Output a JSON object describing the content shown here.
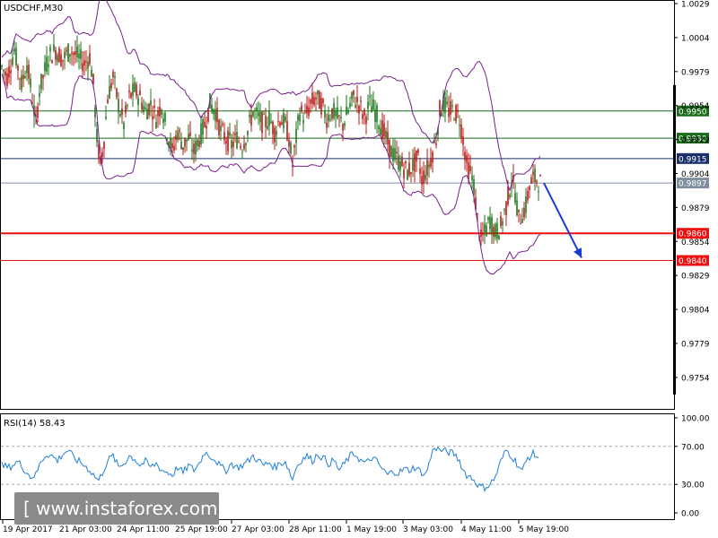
{
  "chart_data": [
    {
      "type": "candlestick",
      "title": "USDCHF,M30",
      "y_ticks": [
        "1.0029",
        "1.0004",
        "0.9979",
        "0.9954",
        "0.9929",
        "0.9904",
        "0.9879",
        "0.9854",
        "0.9829",
        "0.9804",
        "0.9779",
        "0.9754"
      ],
      "x_ticks": [
        "19 Apr 2017",
        "21 Apr 03:00",
        "24 Apr 11:00",
        "25 Apr 19:00",
        "27 Apr 03:00",
        "28 Apr 11:00",
        "1 May 19:00",
        "3 May 03:00",
        "4 May 11:00",
        "5 May 19:00"
      ],
      "levels": [
        {
          "label": "0.9950",
          "value": 0.995,
          "color": "#1a6b1a"
        },
        {
          "label": "0.9930",
          "value": 0.993,
          "color": "#1a6b1a"
        },
        {
          "label": "0.9915",
          "value": 0.9915,
          "color": "#1a2f6b"
        },
        {
          "label": "0.9897",
          "value": 0.9897,
          "color": "#7f8f9f"
        },
        {
          "label": "0.9860",
          "value": 0.986,
          "color": "#ee1111"
        },
        {
          "label": "0.9840",
          "value": 0.984,
          "color": "#ee1111"
        }
      ],
      "price_path": [
        [
          0,
          0.9985
        ],
        [
          8,
          0.9975
        ],
        [
          16,
          0.9995
        ],
        [
          24,
          0.997
        ],
        [
          30,
          0.9985
        ],
        [
          36,
          0.996
        ],
        [
          40,
          0.994
        ],
        [
          44,
          0.9965
        ],
        [
          48,
          0.9975
        ],
        [
          54,
          0.999
        ],
        [
          62,
          0.9995
        ],
        [
          70,
          0.9988
        ],
        [
          78,
          0.9995
        ],
        [
          86,
          0.999
        ],
        [
          94,
          0.9985
        ],
        [
          100,
          0.999
        ],
        [
          104,
          0.997
        ],
        [
          108,
          0.993
        ],
        [
          112,
          0.991
        ],
        [
          116,
          0.993
        ],
        [
          120,
          0.996
        ],
        [
          126,
          0.9975
        ],
        [
          132,
          0.9955
        ],
        [
          138,
          0.994
        ],
        [
          144,
          0.996
        ],
        [
          150,
          0.9965
        ],
        [
          156,
          0.996
        ],
        [
          162,
          0.995
        ],
        [
          168,
          0.9955
        ],
        [
          174,
          0.9945
        ],
        [
          180,
          0.9955
        ],
        [
          186,
          0.9935
        ],
        [
          192,
          0.992
        ],
        [
          198,
          0.9935
        ],
        [
          204,
          0.9925
        ],
        [
          210,
          0.993
        ],
        [
          216,
          0.992
        ],
        [
          222,
          0.993
        ],
        [
          228,
          0.994
        ],
        [
          234,
          0.9955
        ],
        [
          240,
          0.995
        ],
        [
          246,
          0.9935
        ],
        [
          252,
          0.993
        ],
        [
          258,
          0.9925
        ],
        [
          264,
          0.993
        ],
        [
          270,
          0.9925
        ],
        [
          276,
          0.9935
        ],
        [
          282,
          0.995
        ],
        [
          288,
          0.9945
        ],
        [
          294,
          0.994
        ],
        [
          300,
          0.9945
        ],
        [
          306,
          0.9935
        ],
        [
          312,
          0.9945
        ],
        [
          318,
          0.994
        ],
        [
          322,
          0.993
        ],
        [
          326,
          0.991
        ],
        [
          330,
          0.993
        ],
        [
          334,
          0.995
        ],
        [
          340,
          0.9945
        ],
        [
          346,
          0.9955
        ],
        [
          352,
          0.996
        ],
        [
          358,
          0.9955
        ],
        [
          364,
          0.9945
        ],
        [
          370,
          0.995
        ],
        [
          376,
          0.9945
        ],
        [
          382,
          0.994
        ],
        [
          388,
          0.995
        ],
        [
          394,
          0.996
        ],
        [
          400,
          0.9955
        ],
        [
          406,
          0.9945
        ],
        [
          412,
          0.9955
        ],
        [
          418,
          0.995
        ],
        [
          424,
          0.994
        ],
        [
          430,
          0.993
        ],
        [
          436,
          0.992
        ],
        [
          442,
          0.9915
        ],
        [
          448,
          0.991
        ],
        [
          454,
          0.9905
        ],
        [
          460,
          0.991
        ],
        [
          466,
          0.9915
        ],
        [
          470,
          0.99
        ],
        [
          474,
          0.9905
        ],
        [
          478,
          0.991
        ],
        [
          482,
          0.992
        ],
        [
          486,
          0.993
        ],
        [
          490,
          0.995
        ],
        [
          494,
          0.9955
        ],
        [
          500,
          0.995
        ],
        [
          506,
          0.995
        ],
        [
          512,
          0.9945
        ],
        [
          516,
          0.993
        ],
        [
          520,
          0.991
        ],
        [
          524,
          0.9905
        ],
        [
          528,
          0.9895
        ],
        [
          532,
          0.987
        ],
        [
          536,
          0.9855
        ],
        [
          540,
          0.986
        ],
        [
          546,
          0.987
        ],
        [
          552,
          0.986
        ],
        [
          558,
          0.9865
        ],
        [
          564,
          0.988
        ],
        [
          570,
          0.99
        ],
        [
          574,
          0.989
        ],
        [
          578,
          0.987
        ],
        [
          582,
          0.9875
        ],
        [
          586,
          0.988
        ],
        [
          590,
          0.9895
        ],
        [
          594,
          0.99
        ],
        [
          598,
          0.99
        ],
        [
          602,
          0.9897
        ]
      ],
      "indicator": {
        "name": "Bollinger Bands"
      },
      "forecast_arrow": {
        "from": [
          606,
          0.9897
        ],
        "to": [
          648,
          0.9842
        ]
      }
    },
    {
      "type": "line",
      "title": "RSI(14) 58.43",
      "y_ticks": [
        "100.00",
        "70.00",
        "30.00",
        "0.00"
      ],
      "levels": [
        70,
        30
      ],
      "values": [
        [
          0,
          50
        ],
        [
          10,
          48
        ],
        [
          20,
          54
        ],
        [
          28,
          45
        ],
        [
          34,
          38
        ],
        [
          40,
          40
        ],
        [
          46,
          55
        ],
        [
          52,
          62
        ],
        [
          58,
          60
        ],
        [
          64,
          55
        ],
        [
          70,
          62
        ],
        [
          76,
          66
        ],
        [
          82,
          58
        ],
        [
          88,
          54
        ],
        [
          94,
          50
        ],
        [
          100,
          45
        ],
        [
          106,
          38
        ],
        [
          110,
          34
        ],
        [
          114,
          42
        ],
        [
          120,
          55
        ],
        [
          126,
          60
        ],
        [
          132,
          48
        ],
        [
          138,
          52
        ],
        [
          144,
          60
        ],
        [
          150,
          57
        ],
        [
          156,
          50
        ],
        [
          162,
          54
        ],
        [
          168,
          48
        ],
        [
          174,
          52
        ],
        [
          180,
          45
        ],
        [
          186,
          43
        ],
        [
          192,
          40
        ],
        [
          198,
          48
        ],
        [
          204,
          42
        ],
        [
          210,
          50
        ],
        [
          216,
          45
        ],
        [
          222,
          52
        ],
        [
          228,
          64
        ],
        [
          234,
          60
        ],
        [
          240,
          56
        ],
        [
          246,
          48
        ],
        [
          252,
          45
        ],
        [
          258,
          52
        ],
        [
          264,
          48
        ],
        [
          270,
          50
        ],
        [
          276,
          54
        ],
        [
          282,
          60
        ],
        [
          288,
          55
        ],
        [
          294,
          50
        ],
        [
          300,
          53
        ],
        [
          306,
          48
        ],
        [
          312,
          52
        ],
        [
          318,
          54
        ],
        [
          322,
          45
        ],
        [
          326,
          35
        ],
        [
          330,
          48
        ],
        [
          336,
          56
        ],
        [
          342,
          60
        ],
        [
          348,
          55
        ],
        [
          354,
          62
        ],
        [
          360,
          58
        ],
        [
          366,
          52
        ],
        [
          372,
          55
        ],
        [
          378,
          45
        ],
        [
          384,
          52
        ],
        [
          390,
          60
        ],
        [
          396,
          62
        ],
        [
          402,
          55
        ],
        [
          408,
          52
        ],
        [
          414,
          58
        ],
        [
          420,
          54
        ],
        [
          426,
          46
        ],
        [
          432,
          40
        ],
        [
          438,
          44
        ],
        [
          444,
          42
        ],
        [
          450,
          46
        ],
        [
          456,
          45
        ],
        [
          462,
          48
        ],
        [
          468,
          44
        ],
        [
          474,
          40
        ],
        [
          478,
          52
        ],
        [
          484,
          70
        ],
        [
          488,
          67
        ],
        [
          494,
          65
        ],
        [
          500,
          64
        ],
        [
          506,
          62
        ],
        [
          512,
          55
        ],
        [
          516,
          45
        ],
        [
          520,
          40
        ],
        [
          524,
          38
        ],
        [
          528,
          35
        ],
        [
          534,
          28
        ],
        [
          540,
          27
        ],
        [
          546,
          30
        ],
        [
          552,
          38
        ],
        [
          558,
          54
        ],
        [
          564,
          66
        ],
        [
          570,
          60
        ],
        [
          576,
          52
        ],
        [
          582,
          44
        ],
        [
          588,
          58
        ],
        [
          594,
          62
        ],
        [
          600,
          58.43
        ]
      ]
    }
  ],
  "watermark": {
    "text": "[  www.instaforex.com ]"
  }
}
